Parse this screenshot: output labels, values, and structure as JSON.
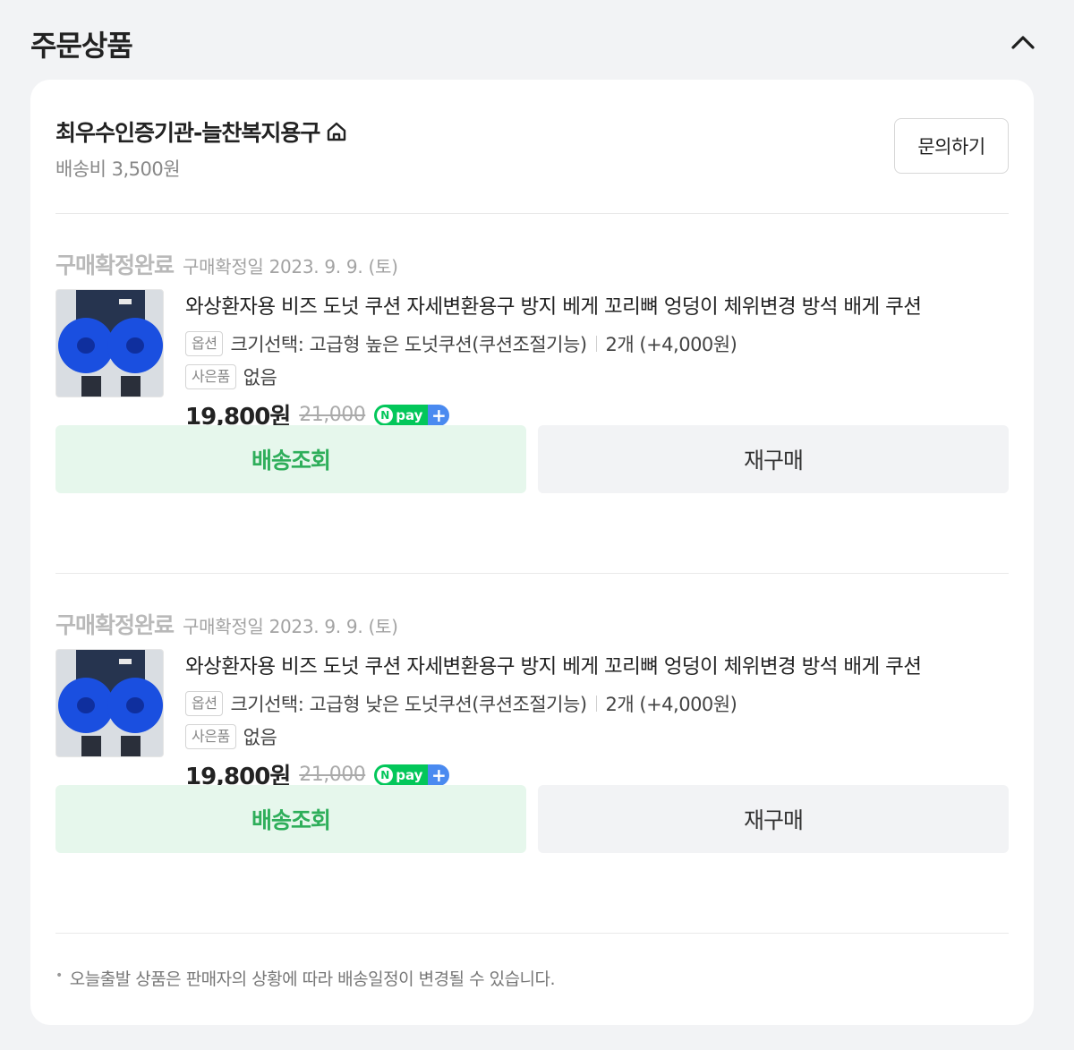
{
  "section": {
    "title": "주문상품"
  },
  "seller": {
    "name": "최우수인증기관-늘찬복지용구",
    "shipping_fee": "배송비 3,500원",
    "inquiry_label": "문의하기"
  },
  "orders": [
    {
      "status": "구매확정완료",
      "confirm_date": "구매확정일 2023. 9. 9. (토)",
      "product_name": "와상환자용 비즈 도넛 쿠션 자세변환용구 방지 베게 꼬리뼈 엉덩이 체위변경 방석 배게 쿠션",
      "option_tag": "옵션",
      "option_text": "크기선택: 고급형 높은 도넛쿠션(쿠션조절기능)",
      "quantity_text": "2개 (+4,000원)",
      "gift_tag": "사은품",
      "gift_text": "없음",
      "price": "19,800원",
      "original_price": "21,000",
      "npay_label": "pay",
      "track_label": "배송조회",
      "rebuy_label": "재구매"
    },
    {
      "status": "구매확정완료",
      "confirm_date": "구매확정일 2023. 9. 9. (토)",
      "product_name": "와상환자용 비즈 도넛 쿠션 자세변환용구 방지 베게 꼬리뼈 엉덩이 체위변경 방석 배게 쿠션",
      "option_tag": "옵션",
      "option_text": "크기선택: 고급형 낮은 도넛쿠션(쿠션조절기능)",
      "quantity_text": "2개 (+4,000원)",
      "gift_tag": "사은품",
      "gift_text": "없음",
      "price": "19,800원",
      "original_price": "21,000",
      "npay_label": "pay",
      "track_label": "배송조회",
      "rebuy_label": "재구매"
    }
  ],
  "notice": "오늘출발 상품은 판매자의 상황에 따라 배송일정이 변경될 수 있습니다.",
  "colors": {
    "accent_green": "#2eae5a",
    "track_bg": "#e6f7ec",
    "npay_green": "#03c75a",
    "npay_blue": "#4a8af0"
  },
  "icons": [
    "chevron-up-icon",
    "home-icon",
    "npay-icon"
  ]
}
